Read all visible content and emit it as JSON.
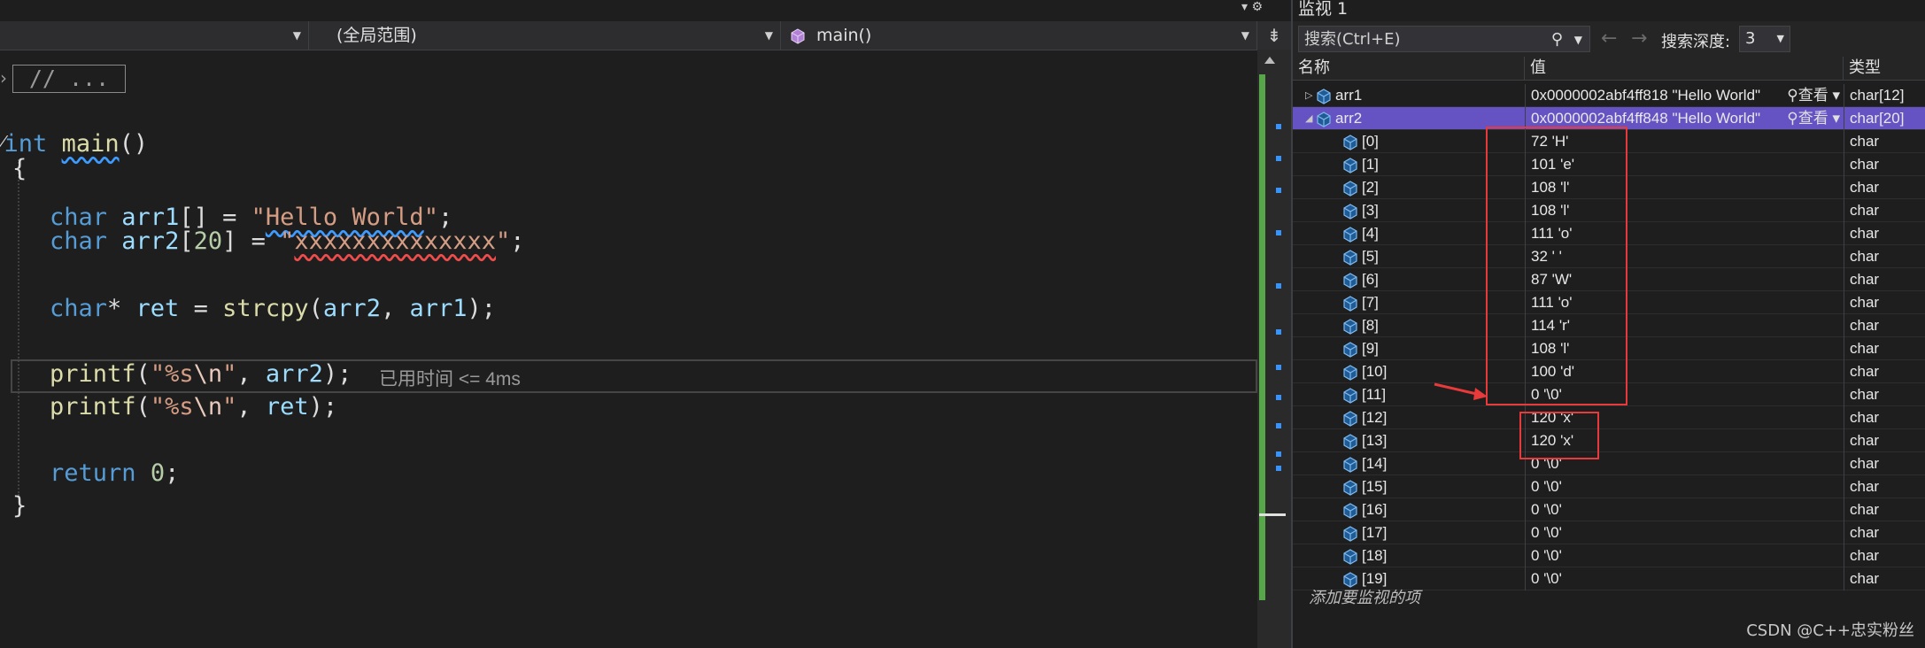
{
  "editor": {
    "nav": {
      "project_combo": "",
      "scope_combo": "(全局范围)",
      "function_combo": "main()"
    },
    "collapsed_block": "// ...",
    "perf_tip": "已用时间 <= 4ms",
    "code": {
      "l1_kw": "int",
      "l1_fn": "main",
      "l1_rest": "()",
      "l2": "{",
      "l3_kw": "char",
      "l3_var": "arr1",
      "l3_mid": "[] = ",
      "l3_q1": "\"",
      "l3_str": "Hello World",
      "l3_q2": "\"",
      "l3_end": ";",
      "l4_kw": "char",
      "l4_var": "arr2",
      "l4_b1": "[",
      "l4_num": "20",
      "l4_b2": "] = ",
      "l4_q1": "\"",
      "l4_str": "xxxxxxxxxxxxxx",
      "l4_q2": "\"",
      "l4_end": ";",
      "l5_kw": "char",
      "l5_star": "* ",
      "l5_var": "ret",
      "l5_eq": " = ",
      "l5_fn": "strcpy",
      "l5_p1": "(",
      "l5_a1": "arr2",
      "l5_c": ", ",
      "l5_a2": "arr1",
      "l5_end": ");",
      "l6_fn": "printf",
      "l6_p1": "(",
      "l6_str1": "\"%s",
      "l6_esc": "\\n",
      "l6_str2": "\"",
      "l6_c": ", ",
      "l6_var": "arr2",
      "l6_end": ");",
      "l7_fn": "printf",
      "l7_p1": "(",
      "l7_str1": "\"%s",
      "l7_esc": "\\n",
      "l7_str2": "\"",
      "l7_c": ", ",
      "l7_var": "ret",
      "l7_end": ");",
      "l8_kw": "return",
      "l8_num": "0",
      "l8_end": ";",
      "l9": "}"
    }
  },
  "watch": {
    "title": "监视 1",
    "search_placeholder": "搜索(Ctrl+E)",
    "depth_label": "搜索深度:",
    "depth_value": "3",
    "columns": {
      "name": "名称",
      "value": "值",
      "type": "类型"
    },
    "view_label": "查看",
    "rows": [
      {
        "name": "arr1",
        "value": "0x0000002abf4ff818 \"Hello World\"",
        "type": "char[12]"
      },
      {
        "name": "arr2",
        "value": "0x0000002abf4ff848 \"Hello World\"",
        "type": "char[20]"
      },
      {
        "name": "[0]",
        "value": "72 'H'",
        "type": "char"
      },
      {
        "name": "[1]",
        "value": "101 'e'",
        "type": "char"
      },
      {
        "name": "[2]",
        "value": "108 'l'",
        "type": "char"
      },
      {
        "name": "[3]",
        "value": "108 'l'",
        "type": "char"
      },
      {
        "name": "[4]",
        "value": "111 'o'",
        "type": "char"
      },
      {
        "name": "[5]",
        "value": "32 ' '",
        "type": "char"
      },
      {
        "name": "[6]",
        "value": "87 'W'",
        "type": "char"
      },
      {
        "name": "[7]",
        "value": "111 'o'",
        "type": "char"
      },
      {
        "name": "[8]",
        "value": "114 'r'",
        "type": "char"
      },
      {
        "name": "[9]",
        "value": "108 'l'",
        "type": "char"
      },
      {
        "name": "[10]",
        "value": "100 'd'",
        "type": "char"
      },
      {
        "name": "[11]",
        "value": "0 '\\0'",
        "type": "char"
      },
      {
        "name": "[12]",
        "value": "120 'x'",
        "type": "char"
      },
      {
        "name": "[13]",
        "value": "120 'x'",
        "type": "char"
      },
      {
        "name": "[14]",
        "value": "0 '\\0'",
        "type": "char"
      },
      {
        "name": "[15]",
        "value": "0 '\\0'",
        "type": "char"
      },
      {
        "name": "[16]",
        "value": "0 '\\0'",
        "type": "char"
      },
      {
        "name": "[17]",
        "value": "0 '\\0'",
        "type": "char"
      },
      {
        "name": "[18]",
        "value": "0 '\\0'",
        "type": "char"
      },
      {
        "name": "[19]",
        "value": "0 '\\0'",
        "type": "char"
      }
    ],
    "add_watch": "添加要监视的项"
  },
  "watermark": "CSDN @C++忠实粉丝",
  "colors": {
    "selection": "#6553c4",
    "annotation_red": "#e83a3a",
    "accent_blue": "#3794ff"
  }
}
